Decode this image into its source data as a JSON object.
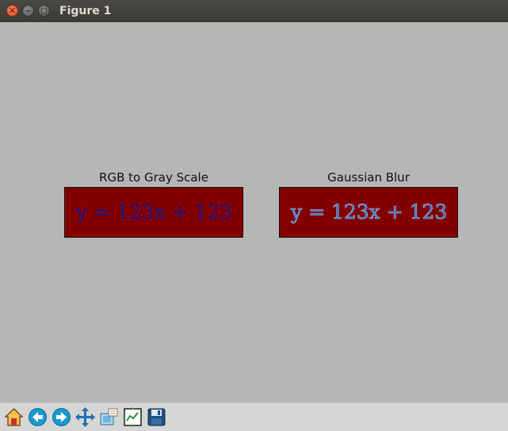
{
  "window": {
    "title": "Figure 1"
  },
  "titlebar_buttons": {
    "close_glyph": "✕",
    "min_glyph": "–",
    "max_glyph": "◻"
  },
  "plots": [
    {
      "title": "RGB to Gray Scale",
      "equation": "y = 123x + 123",
      "background": "#820000",
      "text_color": "#1a1a8e"
    },
    {
      "title": "Gaussian Blur",
      "equation": "y = 123x + 123",
      "background": "#820000",
      "text_color": "#2f6fc9"
    }
  ],
  "toolbar": {
    "icons": [
      "home-icon",
      "back-arrow-icon",
      "forward-arrow-icon",
      "pan-icon",
      "zoom-icon",
      "configure-subplots-icon",
      "save-icon"
    ]
  }
}
